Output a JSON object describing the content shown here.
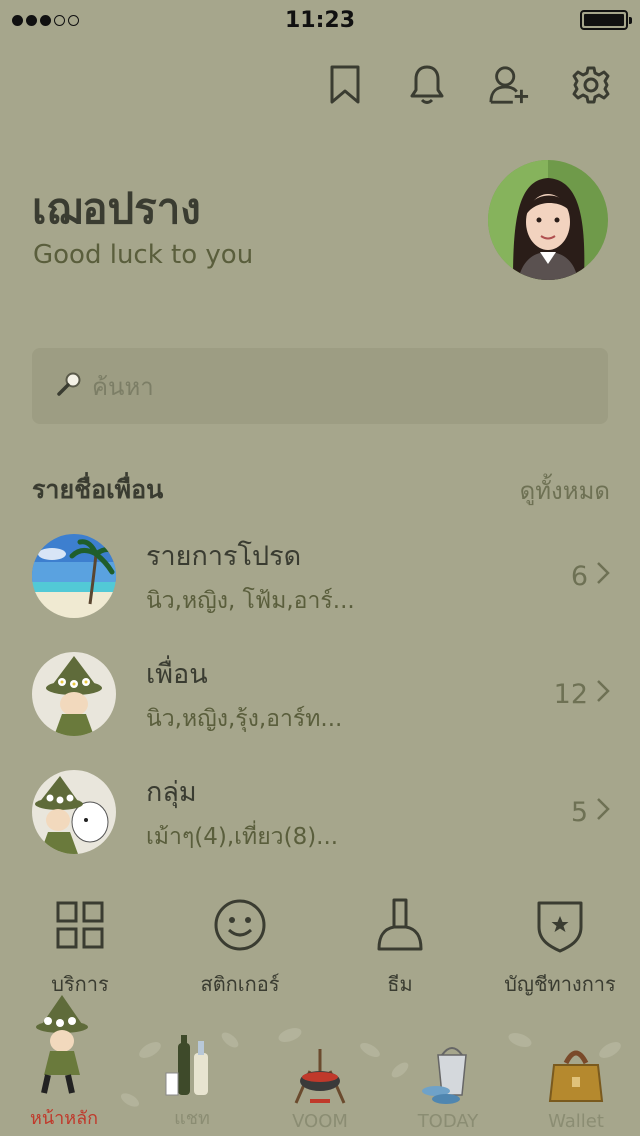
{
  "status_bar": {
    "time": "11:23"
  },
  "profile": {
    "name": "เฌอปราง",
    "status": "Good luck to you"
  },
  "search": {
    "placeholder": "ค้นหา"
  },
  "friends_section": {
    "title": "รายชื่อเพื่อน",
    "see_all": "ดูทั้งหมด"
  },
  "friend_groups": [
    {
      "title": "รายการโปรด",
      "subtitle": "นิว,หญิง, โฟ้ม,อาร์...",
      "count": "6"
    },
    {
      "title": "เพื่อน",
      "subtitle": "นิว,หญิง,รุ้ง,อาร์ท...",
      "count": "12"
    },
    {
      "title": "กลุ่ม",
      "subtitle": "เม้าๆ(4),เที่ยว(8)...",
      "count": "5"
    }
  ],
  "quick_actions": [
    {
      "label": "บริการ",
      "icon": "grid-icon"
    },
    {
      "label": "สติกเกอร์",
      "icon": "smiley-icon"
    },
    {
      "label": "ธีม",
      "icon": "brush-icon"
    },
    {
      "label": "บัญชีทางการ",
      "icon": "shield-star-icon"
    }
  ],
  "tabs": [
    {
      "label": "หน้าหลัก",
      "active": true
    },
    {
      "label": "แชท",
      "active": false
    },
    {
      "label": "VOOM",
      "active": false
    },
    {
      "label": "TODAY",
      "active": false
    },
    {
      "label": "Wallet",
      "active": false
    }
  ],
  "colors": {
    "background": "#a6a68c",
    "text": "#36382e",
    "accent_active_tab": "#c0392b"
  }
}
